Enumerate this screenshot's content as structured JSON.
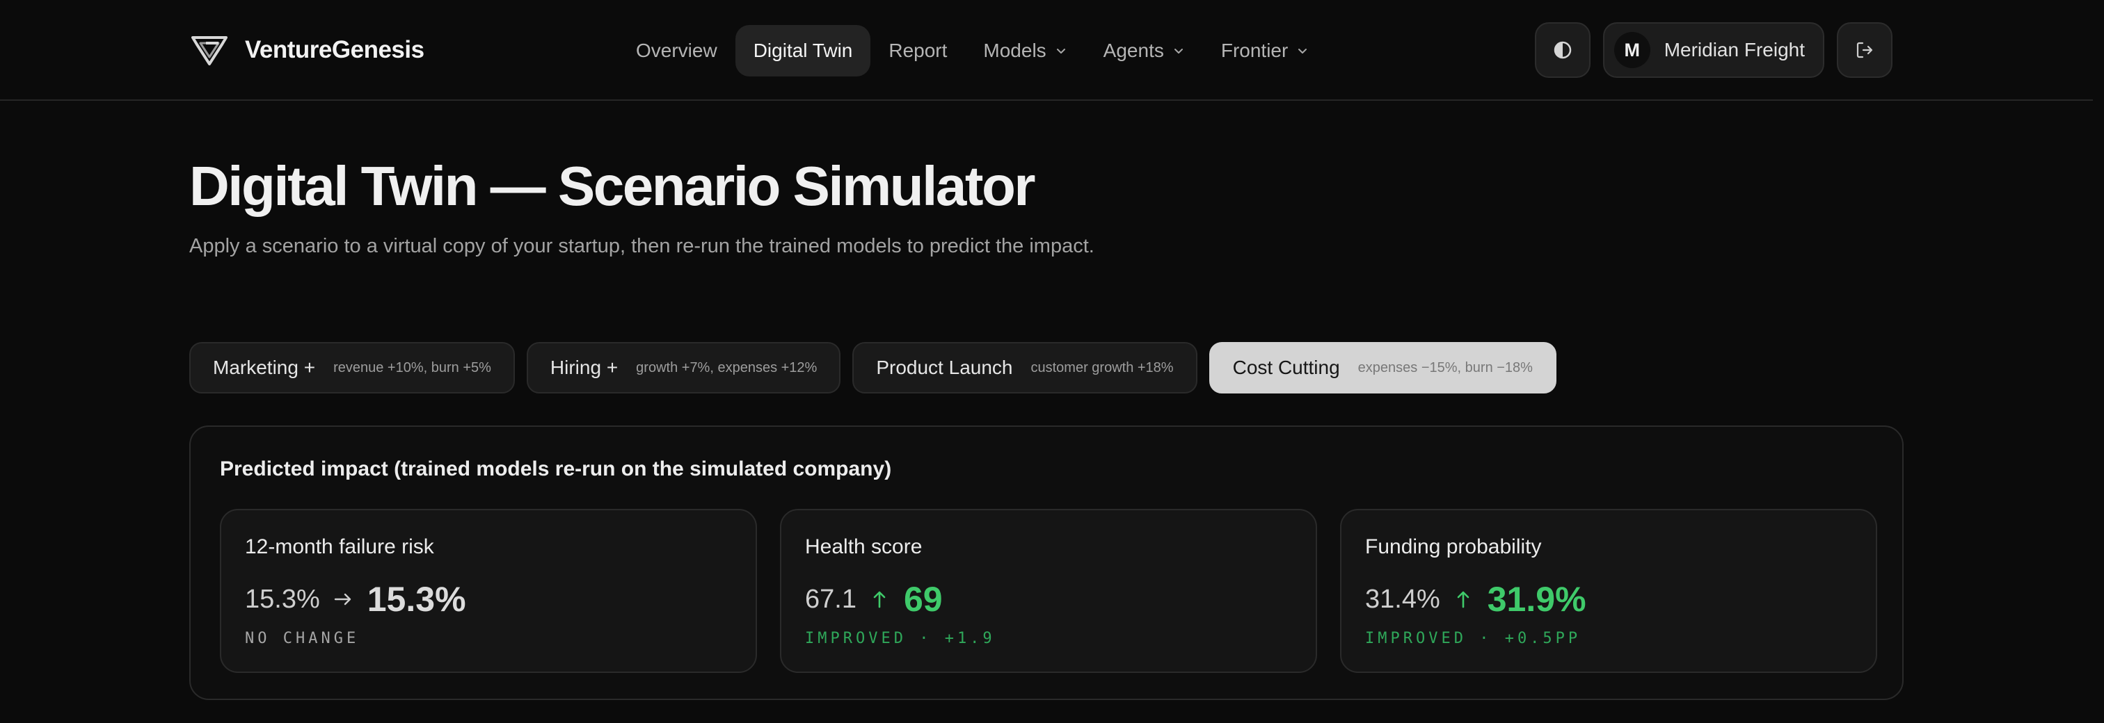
{
  "brand": {
    "name": "VentureGenesis",
    "logo_icon": "triangle-chevron-logo"
  },
  "nav": {
    "items": [
      {
        "label": "Overview",
        "active": false,
        "dropdown": false
      },
      {
        "label": "Digital Twin",
        "active": true,
        "dropdown": false
      },
      {
        "label": "Report",
        "active": false,
        "dropdown": false
      },
      {
        "label": "Models",
        "active": false,
        "dropdown": true
      },
      {
        "label": "Agents",
        "active": false,
        "dropdown": true
      },
      {
        "label": "Frontier",
        "active": false,
        "dropdown": true
      }
    ]
  },
  "header_right": {
    "theme_icon": "contrast-icon",
    "account": {
      "initial": "M",
      "name": "Meridian Freight"
    },
    "logout_icon": "logout-icon"
  },
  "page": {
    "title": "Digital Twin — Scenario Simulator",
    "subtitle": "Apply a scenario to a virtual copy of your startup, then re-run the trained models to predict the impact."
  },
  "scenarios": [
    {
      "label": "Marketing +",
      "detail": "revenue +10%, burn +5%",
      "active": false
    },
    {
      "label": "Hiring +",
      "detail": "growth +7%, expenses +12%",
      "active": false
    },
    {
      "label": "Product Launch",
      "detail": "customer growth +18%",
      "active": false
    },
    {
      "label": "Cost Cutting",
      "detail": "expenses −15%, burn −18%",
      "active": true
    }
  ],
  "impact": {
    "title": "Predicted impact (trained models re-run on the simulated company)",
    "metrics": [
      {
        "title": "12-month failure risk",
        "before": "15.3%",
        "after": "15.3%",
        "direction": "flat",
        "status": "NO CHANGE"
      },
      {
        "title": "Health score",
        "before": "67.1",
        "after": "69",
        "direction": "up",
        "status": "IMPROVED · +1.9"
      },
      {
        "title": "Funding probability",
        "before": "31.4%",
        "after": "31.9%",
        "direction": "up",
        "status": "IMPROVED · +0.5PP"
      }
    ]
  },
  "colors": {
    "background": "#0b0b0b",
    "positive": "#3fca6a",
    "active_chip": "#d4d4d4"
  }
}
